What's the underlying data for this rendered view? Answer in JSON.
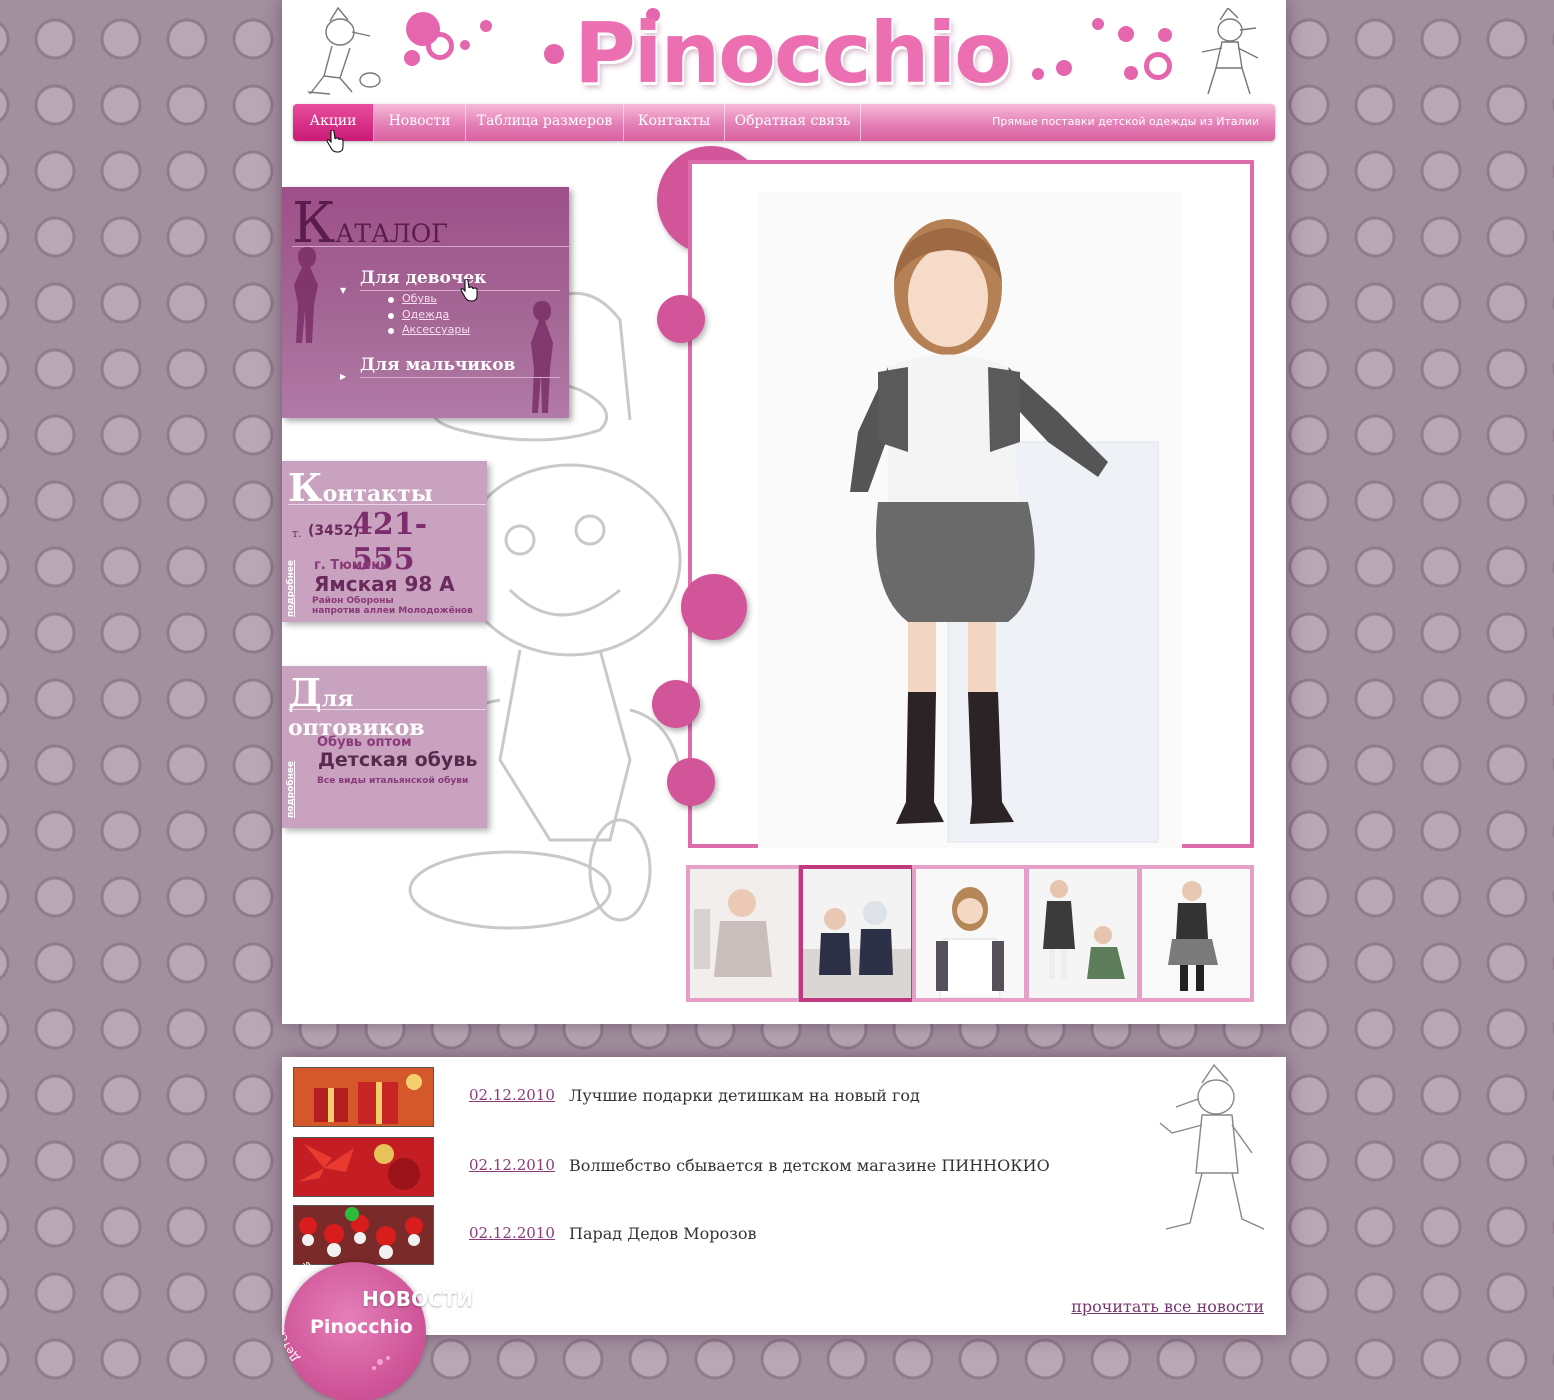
{
  "brand": {
    "logo": "Pinocchio",
    "accent": "#e566ad",
    "dark_accent": "#5a1c4c"
  },
  "nav": {
    "items": [
      {
        "label": "Акции"
      },
      {
        "label": "Новости"
      },
      {
        "label": "Таблица размеров"
      },
      {
        "label": "Контакты"
      },
      {
        "label": "Обратная связь"
      }
    ],
    "tagline": "Прямые поставки детской одежды из Италии"
  },
  "catalog": {
    "title_first": "К",
    "title_rest": "аталог",
    "girls": {
      "label": "Для девочек",
      "items": [
        "Обувь",
        "Одежда",
        "Аксессуары"
      ]
    },
    "boys": {
      "label": "Для мальчиков"
    }
  },
  "contacts": {
    "title_first": "К",
    "title_rest": "онтакты",
    "phone_prefix": "т.",
    "phone_code": "(3452)",
    "phone_number": "421-555",
    "city": "г. Тюмень",
    "address": "Ямская 98 А",
    "district": "Район Обороны",
    "landmark": "напротив аллеи Молодожёнов",
    "more": "подробнее"
  },
  "wholesale": {
    "title_first": "Д",
    "title_rest": "ля оптовиков",
    "subtitle": "Обувь оптом",
    "headline": "Детская обувь",
    "description": "Все виды итальянской обуви",
    "more": "подробнее"
  },
  "news": {
    "items": [
      {
        "date": "02.12.2010",
        "title": "Лучшие подарки детишкам на новый год"
      },
      {
        "date": "02.12.2010",
        "title": "Волшебство сбывается в детском магазине ПИННОКИО"
      },
      {
        "date": "02.12.2010",
        "title": "Парад Дедов Морозов"
      }
    ],
    "read_all": "прочитать все новости",
    "badge_label": "НОВОСТИ",
    "badge_logo": "Pinocchio",
    "badge_arc": "Детская одежда и обувь"
  }
}
